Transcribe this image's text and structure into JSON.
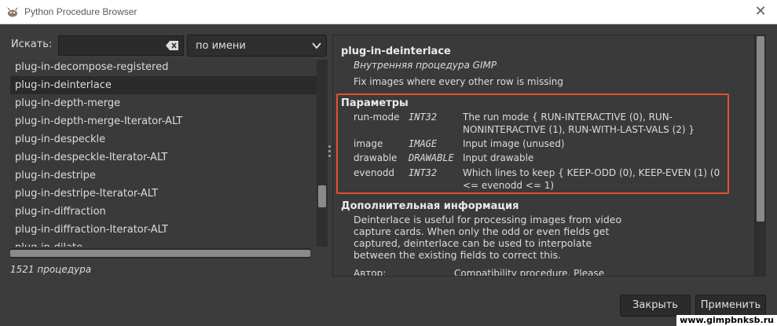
{
  "window": {
    "title": "Python Procedure Browser"
  },
  "search": {
    "label": "Искать:",
    "value": "",
    "placeholder": ""
  },
  "search_mode": {
    "selected": "по имени"
  },
  "procedure_list": {
    "items": [
      "plug-in-decompose-registered",
      "plug-in-deinterlace",
      "plug-in-depth-merge",
      "plug-in-depth-merge-Iterator-ALT",
      "plug-in-despeckle",
      "plug-in-despeckle-Iterator-ALT",
      "plug-in-destripe",
      "plug-in-destripe-Iterator-ALT",
      "plug-in-diffraction",
      "plug-in-diffraction-Iterator-ALT",
      "plug-in-dilate"
    ],
    "selected_index": 1,
    "count_text": "1521 процедура"
  },
  "detail": {
    "name": "plug-in-deinterlace",
    "type": "Внутренняя процедура GIMP",
    "blurb": "Fix images where every other row is missing",
    "params_title": "Параметры",
    "params": [
      {
        "name": "run-mode",
        "type": "INT32",
        "desc": "The run mode { RUN-INTERACTIVE (0), RUN-NONINTERACTIVE (1), RUN-WITH-LAST-VALS (2) }"
      },
      {
        "name": "image",
        "type": "IMAGE",
        "desc": "Input image (unused)"
      },
      {
        "name": "drawable",
        "type": "DRAWABLE",
        "desc": "Input drawable"
      },
      {
        "name": "evenodd",
        "type": "INT32",
        "desc": "Which lines to keep { KEEP-ODD (0), KEEP-EVEN (1) (0 <= evenodd <= 1)"
      }
    ],
    "info_title": "Дополнительная информация",
    "info_text": "Deinterlace is useful for processing images from video capture cards. When only the odd or even fields get captured, deinterlace can be used to interpolate between the existing fields to correct this.",
    "author_label": "Автор:",
    "author_value": "Compatibility procedure. Please"
  },
  "buttons": {
    "close": "Закрыть",
    "apply": "Применить"
  },
  "watermark": "www.gimpbnksb.ru",
  "colors": {
    "highlight_border": "#e0542a",
    "background": "#3c3c3c"
  }
}
